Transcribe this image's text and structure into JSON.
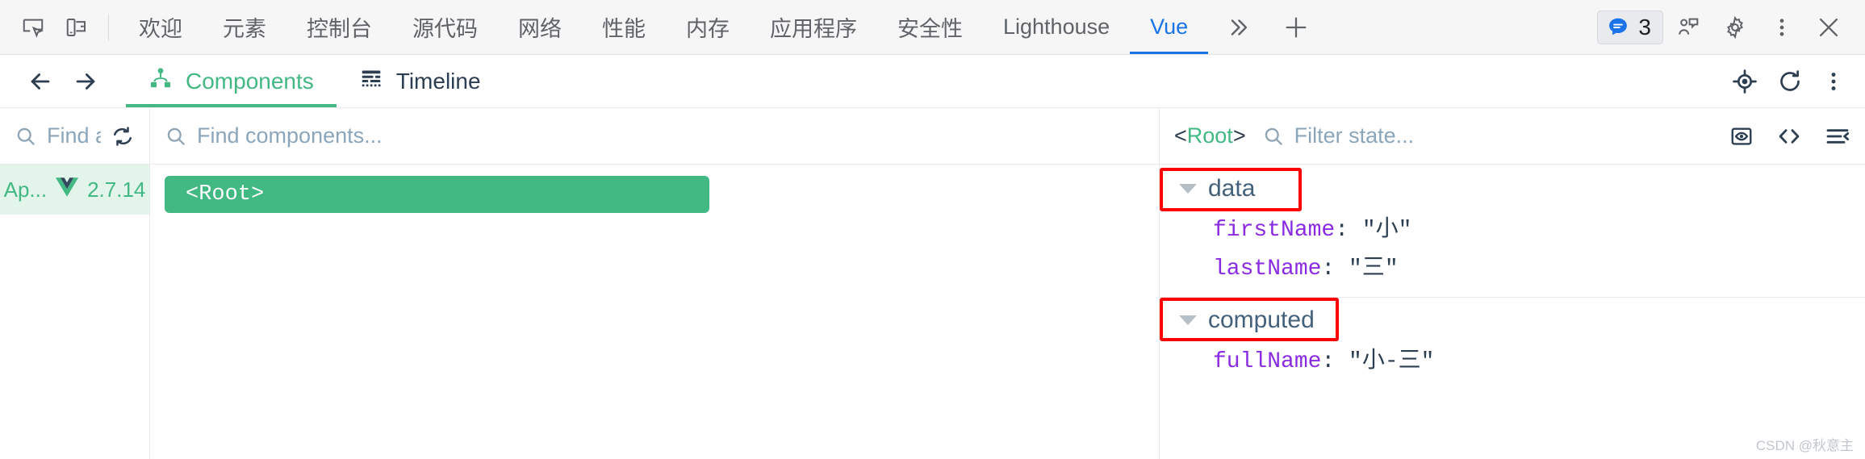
{
  "devtools": {
    "left_icons": [
      {
        "name": "inspect-element-icon"
      },
      {
        "name": "device-toolbar-icon"
      }
    ],
    "tabs": [
      {
        "label": "欢迎",
        "active": false
      },
      {
        "label": "元素",
        "active": false
      },
      {
        "label": "控制台",
        "active": false
      },
      {
        "label": "源代码",
        "active": false
      },
      {
        "label": "网络",
        "active": false
      },
      {
        "label": "性能",
        "active": false
      },
      {
        "label": "内存",
        "active": false
      },
      {
        "label": "应用程序",
        "active": false
      },
      {
        "label": "安全性",
        "active": false
      },
      {
        "label": "Lighthouse",
        "active": false
      },
      {
        "label": "Vue",
        "active": true
      }
    ],
    "overflow_label": "»",
    "add_tab_label": "+",
    "issues_count": "3",
    "right_icons": [
      {
        "name": "issues-chip-icon"
      },
      {
        "name": "feedback-icon"
      },
      {
        "name": "settings-gear-icon"
      },
      {
        "name": "more-options-icon"
      },
      {
        "name": "close-devtools-icon"
      }
    ],
    "accent_color": "#1a73e8"
  },
  "vue_header": {
    "back_label": "←",
    "forward_label": "→",
    "tabs": [
      {
        "label": "Components",
        "icon": "components-tree-icon",
        "active": true
      },
      {
        "label": "Timeline",
        "icon": "timeline-icon",
        "active": false
      }
    ],
    "right_icons": [
      {
        "name": "select-component-icon"
      },
      {
        "name": "refresh-icon"
      },
      {
        "name": "more-options-icon"
      }
    ],
    "accent_color": "#42b883"
  },
  "apps_panel": {
    "search_placeholder": "Find a",
    "search_value": "",
    "refresh_icon": "refresh-apps-icon",
    "items": [
      {
        "name": "Ap...",
        "version": "2.7.14",
        "selected": true
      }
    ]
  },
  "tree_panel": {
    "search_placeholder": "Find components...",
    "search_value": "",
    "nodes": [
      {
        "label": "<Root>",
        "selected": true
      }
    ]
  },
  "state_panel": {
    "selected_component_open": "<",
    "selected_component_name": "Root",
    "selected_component_close": ">",
    "filter_placeholder": "Filter state...",
    "filter_value": "",
    "icons": [
      {
        "name": "inspect-dom-icon"
      },
      {
        "name": "open-in-editor-icon"
      },
      {
        "name": "collapse-all-icon"
      }
    ],
    "groups": [
      {
        "name": "data",
        "highlighted": true,
        "expanded": true,
        "entries": [
          {
            "key": "firstName",
            "value": "\"小\""
          },
          {
            "key": "lastName",
            "value": "\"三\""
          }
        ]
      },
      {
        "name": "computed",
        "highlighted": true,
        "expanded": true,
        "entries": [
          {
            "key": "fullName",
            "value": "\"小-三\""
          }
        ]
      }
    ]
  },
  "watermark": "CSDN @秋意主"
}
